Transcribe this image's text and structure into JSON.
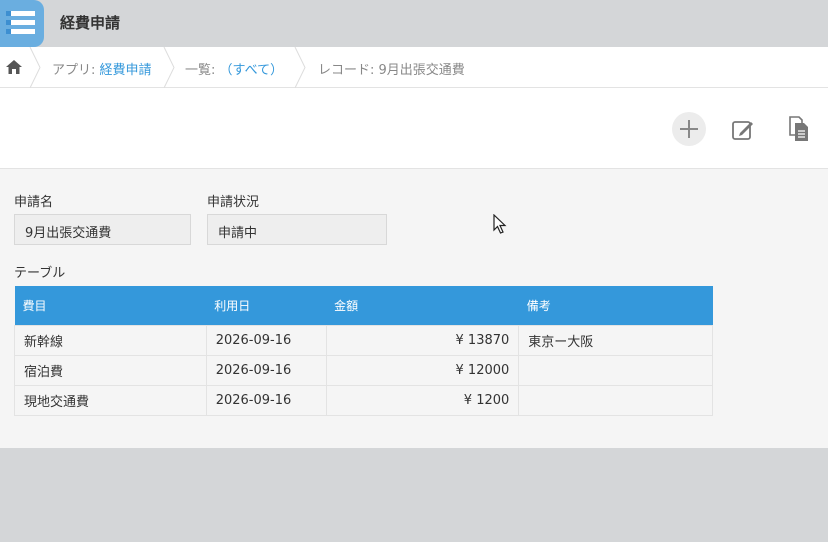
{
  "header": {
    "title": "経費申請",
    "app_icon": "list-icon"
  },
  "breadcrumb": {
    "home_icon": "home-icon",
    "app_prefix": "アプリ: ",
    "app_link": "経費申請",
    "list_prefix": "一覧: ",
    "list_link": "（すべて）",
    "record_text": "レコード: 9月出張交通費"
  },
  "toolbar": {
    "add_icon": "plus-icon",
    "edit_icon": "edit-icon",
    "copy_icon": "copy-document-icon"
  },
  "fields": {
    "name_label": "申請名",
    "name_value": "9月出張交通費",
    "status_label": "申請状況",
    "status_value": "申請中"
  },
  "table": {
    "label": "テーブル",
    "headers": [
      "費目",
      "利用日",
      "金額",
      "備考"
    ],
    "rows": [
      [
        "新幹線",
        "2026-09-16",
        "¥ 13870",
        "東京ー大阪"
      ],
      [
        "宿泊費",
        "2026-09-16",
        "¥ 12000",
        ""
      ],
      [
        "現地交通費",
        "2026-09-16",
        "¥ 1200",
        ""
      ]
    ]
  },
  "colors": {
    "accent": "#3498db",
    "link": "#3498db",
    "header_bg": "#d4d6d8"
  }
}
